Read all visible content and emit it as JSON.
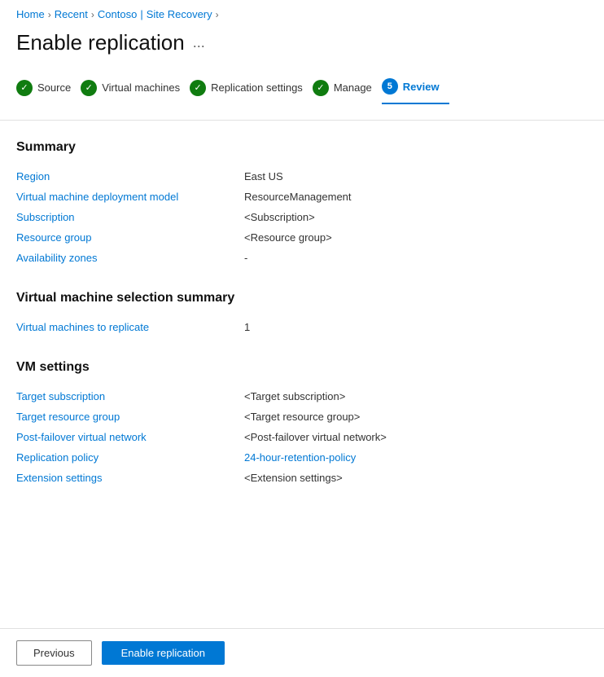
{
  "breadcrumb": {
    "home": "Home",
    "recent": "Recent",
    "contoso": "Contoso",
    "pipe": "|",
    "site_recovery": "Site Recovery"
  },
  "page": {
    "title": "Enable replication",
    "dots_label": "..."
  },
  "steps": [
    {
      "id": "source",
      "label": "Source",
      "state": "complete",
      "num": null
    },
    {
      "id": "virtual-machines",
      "label": "Virtual machines",
      "state": "complete",
      "num": null
    },
    {
      "id": "replication-settings",
      "label": "Replication settings",
      "state": "complete",
      "num": null
    },
    {
      "id": "manage",
      "label": "Manage",
      "state": "complete",
      "num": null
    },
    {
      "id": "review",
      "label": "Review",
      "state": "active",
      "num": "5"
    }
  ],
  "summary_section": {
    "title": "Summary",
    "rows": [
      {
        "label": "Region",
        "value": "East US",
        "is_link": false
      },
      {
        "label": "Virtual machine deployment model",
        "value": "ResourceManagement",
        "is_link": false
      },
      {
        "label": "Subscription",
        "value": "<Subscription>",
        "is_link": false
      },
      {
        "label": "Resource group",
        "value": "<Resource group>",
        "is_link": false
      },
      {
        "label": "Availability zones",
        "value": "-",
        "is_link": false
      }
    ]
  },
  "vm_selection_section": {
    "title": "Virtual machine selection summary",
    "rows": [
      {
        "label": "Virtual machines to replicate",
        "value": "1",
        "is_link": false
      }
    ]
  },
  "vm_settings_section": {
    "title": "VM settings",
    "rows": [
      {
        "label": "Target subscription",
        "value": "<Target subscription>",
        "is_link": false
      },
      {
        "label": "Target resource group",
        "value": "<Target resource group>",
        "is_link": false
      },
      {
        "label": "Post-failover virtual network",
        "value": "<Post-failover virtual network>",
        "is_link": false
      },
      {
        "label": "Replication policy",
        "value": "24-hour-retention-policy",
        "is_link": true
      },
      {
        "label": "Extension settings",
        "value": "<Extension settings>",
        "is_link": false
      }
    ]
  },
  "footer": {
    "previous_label": "Previous",
    "enable_label": "Enable replication"
  }
}
